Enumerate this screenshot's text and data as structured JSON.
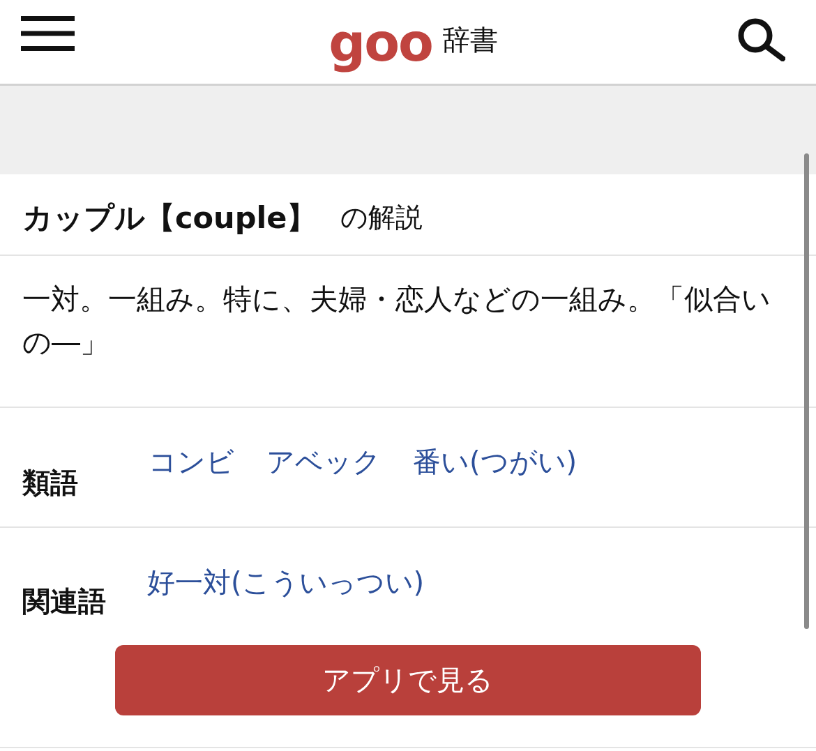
{
  "header": {
    "logo": "goo",
    "title": "辞書"
  },
  "entry": {
    "headword": "カップル【couple】",
    "suffix": "の解説"
  },
  "definition": "一対。一組み。特に、夫婦・恋人などの一組み。「似合いの―」",
  "relations": [
    {
      "label": "類語",
      "links": [
        "コンビ",
        "アベック",
        "番い(つがい)"
      ]
    },
    {
      "label": "関連語",
      "links": [
        "好一対(こういっつい)"
      ]
    }
  ],
  "app_button": "アプリで見る"
}
